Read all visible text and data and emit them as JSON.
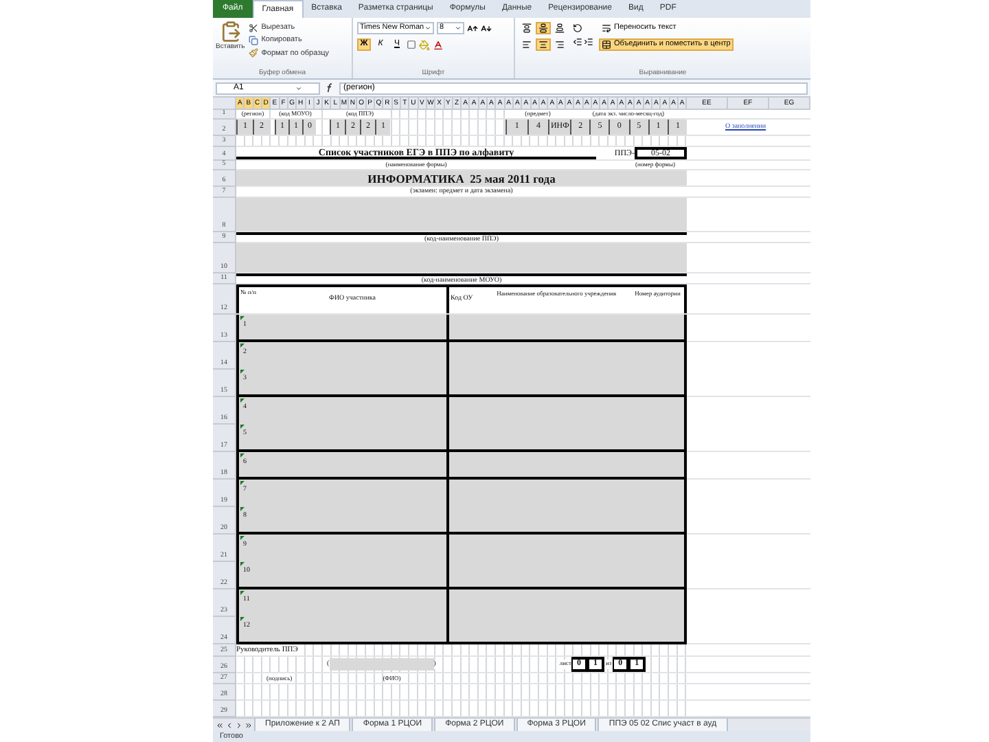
{
  "ribbon": {
    "tabs": [
      {
        "label": "Файл",
        "kind": "file"
      },
      {
        "label": "Главная",
        "kind": "tab",
        "selected": true
      },
      {
        "label": "Вставка",
        "kind": "tab",
        "selected": false
      },
      {
        "label": "Разметка страницы",
        "kind": "tab",
        "selected": false
      },
      {
        "label": "Формулы",
        "kind": "tab",
        "selected": false
      },
      {
        "label": "Данные",
        "kind": "tab",
        "selected": false
      },
      {
        "label": "Рецензирование",
        "kind": "tab",
        "selected": false
      },
      {
        "label": "Вид",
        "kind": "tab",
        "selected": false
      },
      {
        "label": "PDF",
        "kind": "tab",
        "selected": false
      }
    ],
    "clipboard": {
      "paste": "Вставить",
      "cut": "Вырезать",
      "copy": "Копировать",
      "format_painter": "Формат по образцу",
      "label": "Буфер обмена"
    },
    "font": {
      "font_name": "Times New Roman",
      "font_size": "8",
      "bold": {
        "text": "Ж",
        "on": true
      },
      "italic": {
        "text": "К",
        "on": false
      },
      "underline": {
        "text": "Ч",
        "on": false
      },
      "label": "Шрифт"
    },
    "alignment": {
      "vertical": [
        {
          "selected": false
        },
        {
          "selected": true
        },
        {
          "selected": false
        }
      ],
      "horizontal": [
        {
          "selected": false
        },
        {
          "selected": true
        },
        {
          "selected": false
        }
      ],
      "wrap": {
        "text": "Переносить текст",
        "on": false
      },
      "merge": {
        "text": "Объединить и поместить в центр",
        "on": true
      },
      "label": "Выравнивание"
    }
  },
  "formula_bar": {
    "cell": "A1",
    "value": "(регион)"
  },
  "column_headers": [
    {
      "label": "A",
      "selected": true
    },
    {
      "label": "B",
      "selected": true
    },
    {
      "label": "C",
      "selected": true
    },
    {
      "label": "D",
      "selected": true
    },
    {
      "label": "E",
      "selected": false
    },
    {
      "label": "F",
      "selected": false
    },
    {
      "label": "G",
      "selected": false
    },
    {
      "label": "H",
      "selected": false
    },
    {
      "label": "I",
      "selected": false
    },
    {
      "label": "J",
      "selected": false
    },
    {
      "label": "K",
      "selected": false
    },
    {
      "label": "L",
      "selected": false
    },
    {
      "label": "M",
      "selected": false
    },
    {
      "label": "N",
      "selected": false
    },
    {
      "label": "O",
      "selected": false
    },
    {
      "label": "P",
      "selected": false
    },
    {
      "label": "Q",
      "selected": false
    },
    {
      "label": "R",
      "selected": false
    },
    {
      "label": "S",
      "selected": false
    },
    {
      "label": "T",
      "selected": false
    },
    {
      "label": "U",
      "selected": false
    },
    {
      "label": "V",
      "selected": false
    },
    {
      "label": "W",
      "selected": false
    },
    {
      "label": "X",
      "selected": false
    },
    {
      "label": "Y",
      "selected": false
    },
    {
      "label": "Z",
      "selected": false
    },
    {
      "label": "A",
      "selected": false
    },
    {
      "label": "A",
      "selected": false
    },
    {
      "label": "A",
      "selected": false
    },
    {
      "label": "A",
      "selected": false
    },
    {
      "label": "A",
      "selected": false
    },
    {
      "label": "A",
      "selected": false
    },
    {
      "label": "A",
      "selected": false
    },
    {
      "label": "A",
      "selected": false
    },
    {
      "label": "A",
      "selected": false
    },
    {
      "label": "A",
      "selected": false
    },
    {
      "label": "A",
      "selected": false
    },
    {
      "label": "A",
      "selected": false
    },
    {
      "label": "A",
      "selected": false
    },
    {
      "label": "A",
      "selected": false
    },
    {
      "label": "A",
      "selected": false
    },
    {
      "label": "A",
      "selected": false
    },
    {
      "label": "A",
      "selected": false
    },
    {
      "label": "A",
      "selected": false
    },
    {
      "label": "A",
      "selected": false
    },
    {
      "label": "A",
      "selected": false
    },
    {
      "label": "A",
      "selected": false
    },
    {
      "label": "A",
      "selected": false
    },
    {
      "label": "A",
      "selected": false
    },
    {
      "label": "A",
      "selected": false
    },
    {
      "label": "A",
      "selected": false
    },
    {
      "label": "A",
      "selected": false
    },
    {
      "label": "EE",
      "selected": false
    },
    {
      "label": "EF",
      "selected": false
    },
    {
      "label": "EG",
      "selected": false
    }
  ],
  "row_numbers": [
    "1",
    "2",
    "3",
    "4",
    "5",
    "6",
    "7",
    "8",
    "9",
    "10",
    "11",
    "12",
    "13",
    "14",
    "15",
    "16",
    "17",
    "18",
    "19",
    "20",
    "21",
    "22",
    "23",
    "24",
    "25",
    "26",
    "27",
    "28",
    "29"
  ],
  "sheet": {
    "code_labels": [
      "(регион)",
      "(код МОУО)",
      "(код ППЭ)",
      "(предмет)",
      "(дата экз. число-месяц-год)"
    ],
    "code_groups": [
      [
        "1",
        "2"
      ],
      [
        "1",
        "1",
        "0"
      ],
      [
        "1",
        "2",
        "2",
        "1"
      ],
      [
        "1",
        "4",
        "ИНФ"
      ],
      [
        "2",
        "5",
        "0",
        "5",
        "1",
        "1"
      ]
    ],
    "link": "О заполнении",
    "form_title": "Список участников ЕГЭ в ППЭ по алфавиту",
    "form_prefix": "ППЭ-",
    "form_number": "05-02",
    "form_title_caption": "(наименование формы)",
    "form_number_caption": "(номер формы)",
    "exam": "ИНФОРМАТИКА  25 мая 2011 года",
    "exam_caption": "(экзамен: предмет и дата экзамена)",
    "ppe_caption": "(код-наименование ППЭ)",
    "mouo_caption": "(код-наименование МОУО)",
    "table": {
      "columns": [
        "№ п/п",
        "ФИО участника",
        "Код ОУ",
        "Наименование образовательного учреждения",
        "Номер аудитории"
      ],
      "groups": [
        {
          "numbers": [
            "1"
          ]
        },
        {
          "numbers": [
            "2",
            "3"
          ]
        },
        {
          "numbers": [
            "4",
            "5"
          ]
        },
        {
          "numbers": [
            "6"
          ]
        },
        {
          "numbers": [
            "7",
            "8"
          ]
        },
        {
          "numbers": [
            "9",
            "10"
          ]
        },
        {
          "numbers": [
            "11",
            "12"
          ]
        }
      ]
    },
    "signature": {
      "title": "Руководитель ППЭ",
      "open": "(",
      "close": ")",
      "sign_caption": "(подпись)",
      "name_caption": "(ФИО)",
      "sheet_label": "лист",
      "sheet_digits": [
        "0",
        "1"
      ],
      "of_label": "из",
      "total_digits": [
        "0",
        "1"
      ]
    }
  },
  "sheet_tabs": [
    {
      "label": "Приложение к 2 АП"
    },
    {
      "label": "Форма 1 РЦОИ"
    },
    {
      "label": "Форма 2 РЦОИ"
    },
    {
      "label": "Форма 3 РЦОИ"
    },
    {
      "label": "ППЭ 05 02 Спис участ в ауд"
    }
  ],
  "status_bar": "Готово"
}
